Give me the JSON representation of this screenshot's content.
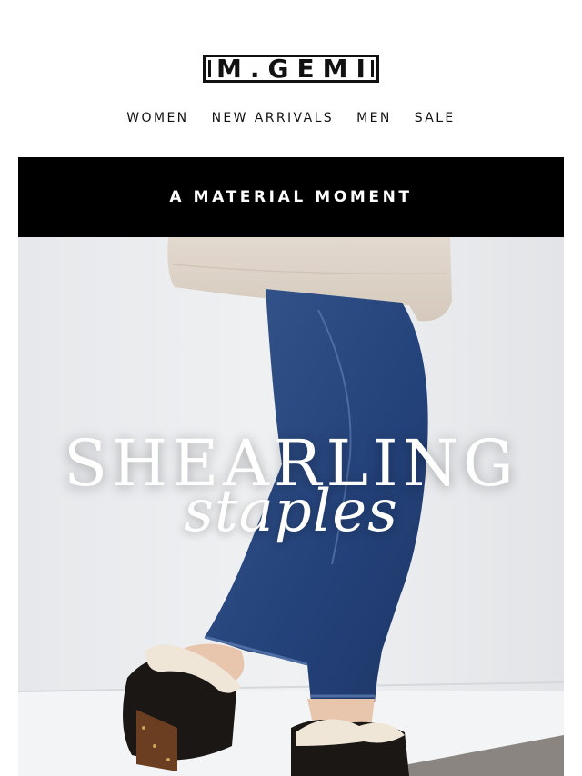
{
  "brand": {
    "logo_text": "M.GEMI"
  },
  "nav": {
    "items": [
      "WOMEN",
      "NEW ARRIVALS",
      "MEN",
      "SALE"
    ]
  },
  "banner": {
    "text": "A MATERIAL MOMENT"
  },
  "hero": {
    "headline": "SHEARLING",
    "script": "staples"
  },
  "colors": {
    "banner_bg": "#000000",
    "text": "#111111",
    "denim": "#2b4a7e",
    "sweater": "#ddd2c7"
  }
}
